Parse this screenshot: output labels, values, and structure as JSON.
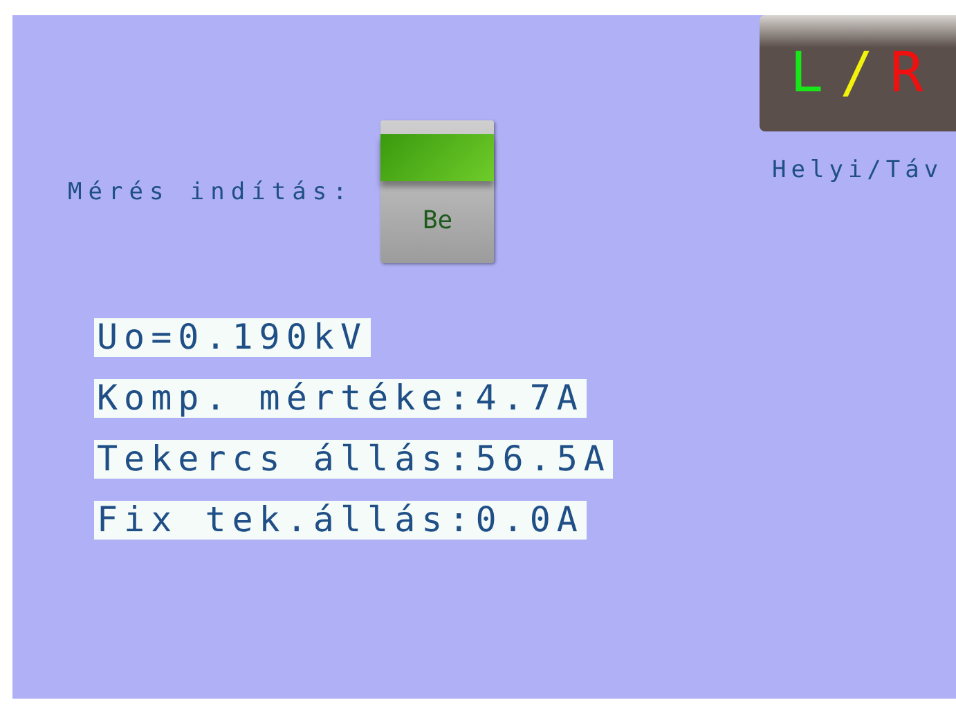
{
  "start": {
    "label": "Mérés indítás:",
    "toggle": {
      "caption": "Be",
      "on": true
    }
  },
  "mode_button": {
    "letters": [
      {
        "text": "L",
        "color": "#19e619"
      },
      {
        "text": "/",
        "color": "#f2f20d"
      },
      {
        "text": "R",
        "color": "#f01010"
      }
    ]
  },
  "mode_label": "Helyi/Táv",
  "readings": [
    "Uo=0.190kV",
    "Komp. mértéke:4.7A",
    "Tekercs állás:56.5A",
    "Fix tek.állás:0.0A"
  ]
}
